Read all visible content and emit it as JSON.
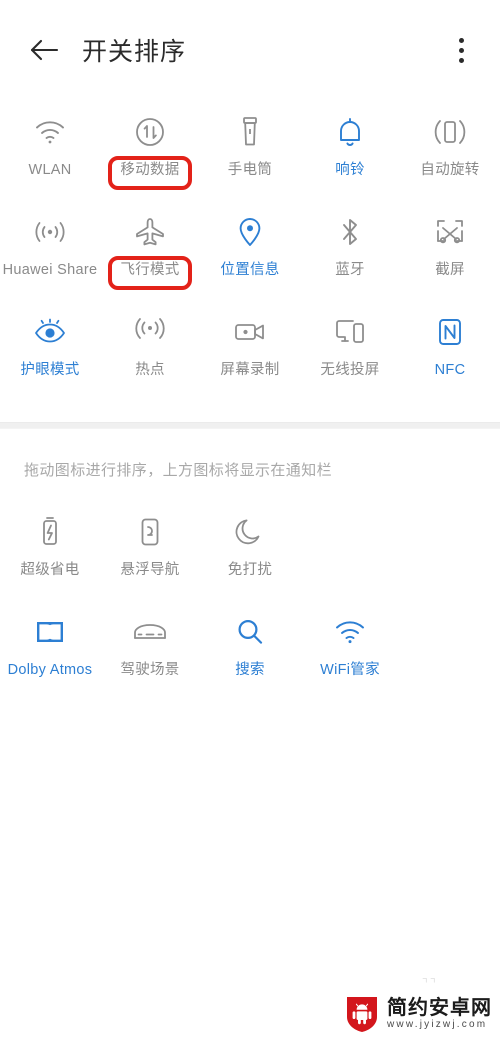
{
  "header": {
    "back_icon": "back-arrow-icon",
    "title": "开关排序",
    "more_icon": "more-vertical-icon"
  },
  "colors": {
    "accent_blue": "#2d7fd3",
    "inactive_gray": "#8a8a8a",
    "marker_red": "#e32219",
    "separator_gray": "#f0f0f0"
  },
  "notification_panel": {
    "tiles": [
      {
        "label": "WLAN",
        "icon": "wifi-icon",
        "active": false,
        "marked": false
      },
      {
        "label": "移动数据",
        "icon": "mobile-data-icon",
        "active": false,
        "marked": true
      },
      {
        "label": "手电筒",
        "icon": "flashlight-icon",
        "active": false,
        "marked": false
      },
      {
        "label": "响铃",
        "icon": "bell-icon",
        "active": true,
        "marked": false
      },
      {
        "label": "自动旋转",
        "icon": "auto-rotate-icon",
        "active": false,
        "marked": false
      },
      {
        "label": "Huawei Share",
        "icon": "huawei-share-icon",
        "active": false,
        "marked": false
      },
      {
        "label": "飞行模式",
        "icon": "airplane-icon",
        "active": false,
        "marked": true
      },
      {
        "label": "位置信息",
        "icon": "location-pin-icon",
        "active": true,
        "marked": false
      },
      {
        "label": "蓝牙",
        "icon": "bluetooth-icon",
        "active": false,
        "marked": false
      },
      {
        "label": "截屏",
        "icon": "screenshot-icon",
        "active": false,
        "marked": false
      },
      {
        "label": "护眼模式",
        "icon": "eye-comfort-icon",
        "active": true,
        "marked": false
      },
      {
        "label": "热点",
        "icon": "hotspot-icon",
        "active": false,
        "marked": false
      },
      {
        "label": "屏幕录制",
        "icon": "screen-record-icon",
        "active": false,
        "marked": false
      },
      {
        "label": "无线投屏",
        "icon": "wireless-cast-icon",
        "active": false,
        "marked": false
      },
      {
        "label": "NFC",
        "icon": "nfc-icon",
        "active": true,
        "marked": false
      }
    ]
  },
  "hint": "拖动图标进行排序，上方图标将显示在通知栏",
  "hidden_panel": {
    "row_one": [
      {
        "label": "超级省电",
        "icon": "battery-saver-icon",
        "active": false
      },
      {
        "label": "悬浮导航",
        "icon": "floating-nav-icon",
        "active": false
      },
      {
        "label": "免打扰",
        "icon": "do-not-disturb-moon-icon",
        "active": false
      }
    ],
    "row_two": [
      {
        "label": "Dolby Atmos",
        "icon": "dolby-atmos-icon",
        "active": true
      },
      {
        "label": "驾驶场景",
        "icon": "driving-mode-car-icon",
        "active": false
      },
      {
        "label": "搜索",
        "icon": "search-icon",
        "active": true
      },
      {
        "label": "WiFi管家",
        "icon": "wifi-manager-icon",
        "active": true
      }
    ]
  },
  "watermark": {
    "logo_icon": "android-shield-logo",
    "site_name": "简约安卓网",
    "site_url": "www.jyizwj.com"
  }
}
